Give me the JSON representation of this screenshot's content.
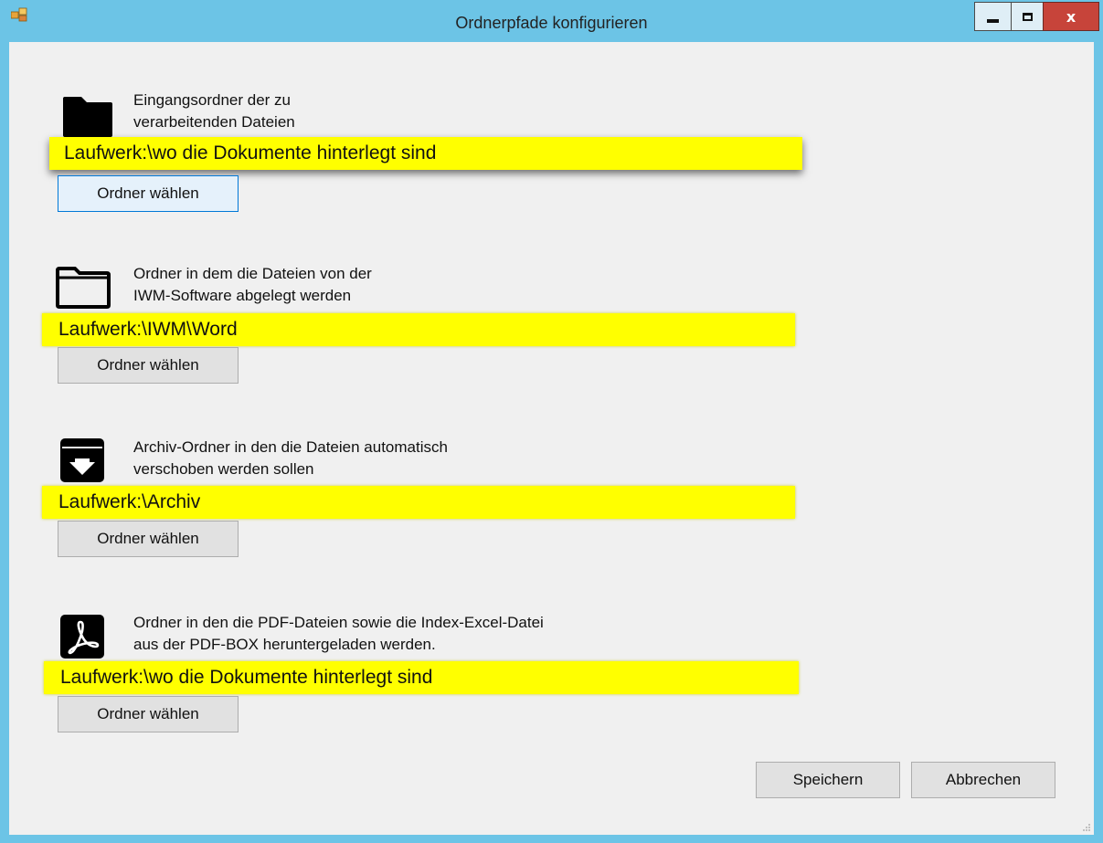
{
  "window": {
    "title": "Ordnerpfade konfigurieren",
    "close_glyph": "x"
  },
  "sections": [
    {
      "icon": "folder-filled-icon",
      "description_line1": "Eingangsordner der zu",
      "description_line2": "verarbeitenden Dateien",
      "path": "Laufwerk:\\wo die Dokumente hinterlegt sind",
      "button_label": "Ordner wählen"
    },
    {
      "icon": "folder-outline-icon",
      "description_line1": "Ordner in dem die Dateien von der",
      "description_line2": "IWM-Software abgelegt werden",
      "path": "Laufwerk:\\IWM\\Word",
      "button_label": "Ordner wählen"
    },
    {
      "icon": "archive-download-icon",
      "description_line1": "Archiv-Ordner in den die Dateien automatisch",
      "description_line2": "verschoben werden sollen",
      "path": "Laufwerk:\\Archiv",
      "button_label": "Ordner wählen"
    },
    {
      "icon": "pdf-icon",
      "description_line1": "Ordner in den die PDF-Dateien sowie die Index-Excel-Datei",
      "description_line2": "aus der PDF-BOX heruntergeladen werden.",
      "path": "Laufwerk:\\wo die Dokumente hinterlegt sind",
      "button_label": "Ordner wählen"
    }
  ],
  "footer": {
    "save_label": "Speichern",
    "cancel_label": "Abbrechen"
  },
  "colors": {
    "titlebar": "#6cc4e6",
    "highlight": "#ffff00",
    "close_button": "#c7443a",
    "client_background": "#f0f0f0"
  }
}
